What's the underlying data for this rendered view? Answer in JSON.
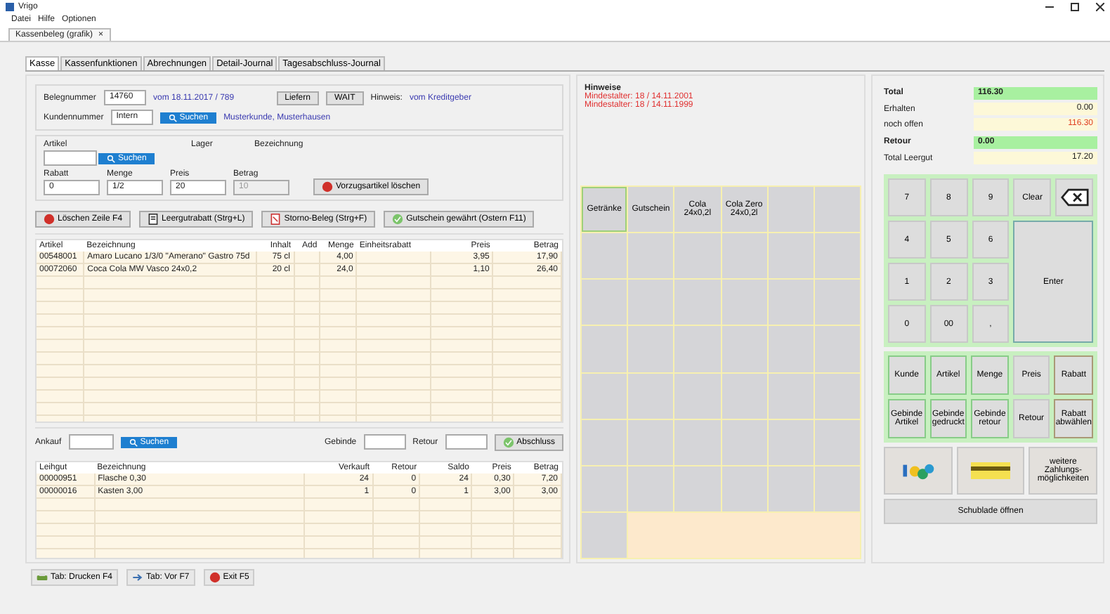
{
  "window": {
    "title": "Vrigo"
  },
  "menu": [
    "Datei",
    "Hilfe",
    "Optionen"
  ],
  "doc_tab": {
    "label": "Kassenbeleg (grafik)",
    "close": "×"
  },
  "tabs": [
    {
      "label": "Kasse",
      "selected": true
    },
    {
      "label": "Kassenfunktionen",
      "selected": false
    },
    {
      "label": "Abrechnungen",
      "selected": false
    },
    {
      "label": "Detail-Journal",
      "selected": false
    },
    {
      "label": "Tagesabschluss-Journal",
      "selected": false
    }
  ],
  "receipt": {
    "number_label": "Belegnummer",
    "number": "14760",
    "date": "vom 18.11.2017 / 789",
    "buttons": [
      "Liefern",
      "WAIT"
    ],
    "note_label": "Hinweis:",
    "note": "vom Kreditgeber",
    "customer_label": "Kundennummer",
    "customer": "Intern",
    "search": "Suchen",
    "customer_name": "Musterkunde, Musterhausen"
  },
  "article": {
    "article_label": "Artikel",
    "stock_label": "Lager",
    "name_label": "Bezeichnung",
    "search": "Suchen",
    "fields": [
      {
        "label": "Rabatt",
        "value": "0",
        "disabled": false
      },
      {
        "label": "Menge",
        "value": "1/2",
        "disabled": false
      },
      {
        "label": "Preis",
        "value": "20",
        "disabled": false
      },
      {
        "label": "Betrag",
        "value": "10",
        "disabled": true
      }
    ],
    "delete_button": "Vorzugsartikel löschen"
  },
  "actions": [
    "Löschen Zeile F4",
    "Leergutrabatt (Strg+L)",
    "Storno-Beleg (Strg+F)",
    "Gutschein gewährt (Ostern F11)"
  ],
  "items_table": {
    "columns": [
      "Artikel",
      "Bezeichnung",
      "Inhalt",
      "Add",
      "Menge",
      "Einheitsrabatt",
      "Preis",
      "Betrag"
    ],
    "rows": [
      [
        "00548001",
        "Amaro Lucano 1/3/0 \"Amerano\" Gastro 75d",
        "75 cl",
        "",
        "4,00",
        "",
        "3,95",
        "17,90"
      ],
      [
        "00072060",
        "Coca Cola MW Vasco 24x0,2",
        "20 cl",
        "",
        "24,0",
        "",
        "1,10",
        "26,40"
      ]
    ]
  },
  "deposit": {
    "purchase_label": "Ankauf",
    "search": "Suchen",
    "container_label": "Gebinde",
    "return_label": "Retour",
    "apply_button": "Abschluss"
  },
  "deposit_table": {
    "columns": [
      "Leihgut",
      "Bezeichnung",
      "Verkauft",
      "Retour",
      "Saldo",
      "Preis",
      "Betrag"
    ],
    "rows": [
      [
        "00000951",
        "Flasche 0,30",
        "24",
        "0",
        "24",
        "0,30",
        "7,20"
      ],
      [
        "00000016",
        "Kasten 3,00",
        "1",
        "0",
        "1",
        "3,00",
        "3,00"
      ]
    ]
  },
  "footer": [
    "Tab: Drucken F4",
    "Tab: Vor F7",
    "Exit F5"
  ],
  "notes": {
    "title": "Hinweise",
    "lines": [
      "Mindestalter: 18 / 14.11.2001",
      "Mindestalter: 18 / 14.11.1999"
    ]
  },
  "product_buttons": [
    {
      "label": "Getränke",
      "selected": true
    },
    {
      "label": "Gutschein",
      "selected": false
    },
    {
      "label": "Cola 24x0,2l",
      "selected": false
    },
    {
      "label": "Cola Zero 24x0,2l",
      "selected": false
    }
  ],
  "totals": [
    {
      "label": "Total",
      "value": "116.30",
      "kind": "main",
      "alert": false
    },
    {
      "label": "Erhalten",
      "value": "0.00",
      "kind": "sub",
      "alert": false
    },
    {
      "label": "noch offen",
      "value": "116.30",
      "kind": "sub",
      "alert": true
    },
    {
      "label": "Retour",
      "value": "0.00",
      "kind": "main",
      "alert": false
    },
    {
      "label": "Total Leergut",
      "value": "17.20",
      "kind": "sub",
      "alert": false
    }
  ],
  "keypad": {
    "keys": [
      "7",
      "8",
      "9",
      "4",
      "5",
      "6",
      "1",
      "2",
      "3",
      "0",
      "00",
      ","
    ],
    "clear": "Clear",
    "enter": "Enter"
  },
  "functions": [
    {
      "label": "Kunde",
      "kind": "green"
    },
    {
      "label": "Artikel",
      "kind": "green"
    },
    {
      "label": "Menge",
      "kind": "green"
    },
    {
      "label": "Preis",
      "kind": "plain"
    },
    {
      "label": "Rabatt",
      "kind": "brown"
    },
    {
      "label": "Gebinde Artikel",
      "kind": "green"
    },
    {
      "label": "Gebinde gedruckt",
      "kind": "green"
    },
    {
      "label": "Gebinde retour",
      "kind": "green"
    },
    {
      "label": "Retour",
      "kind": "plain"
    },
    {
      "label": "Rabatt abwählen",
      "kind": "brown"
    }
  ],
  "payment": {
    "more": "weitere Zahlungs-möglichkeiten",
    "drawer": "Schublade öffnen"
  }
}
